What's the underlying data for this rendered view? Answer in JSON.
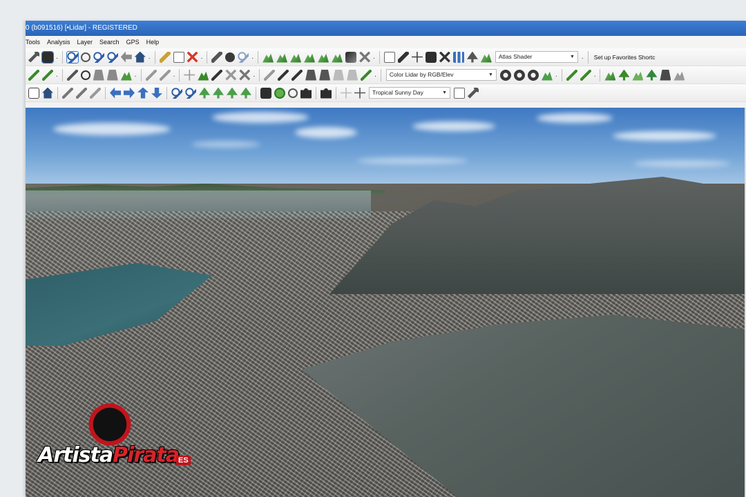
{
  "window": {
    "title": "0 (b091516) [•Lidar] - REGISTERED"
  },
  "menu": [
    "Tools",
    "Analysis",
    "Layer",
    "Search",
    "GPS",
    "Help"
  ],
  "toolbar1": {
    "shader_dropdown": "Atlas Shader",
    "favorites_label": "Set up Favorites Shortc"
  },
  "toolbar2": {
    "lidar_color_dropdown": "Color Lidar by RGB/Elev"
  },
  "toolbar3": {
    "sky_dropdown": "Tropical Sunny Day"
  },
  "watermark": {
    "word1": "Artista",
    "word2": "Pirata",
    "suffix": "ES"
  },
  "icons": {
    "toolbar1": [
      "wrench-icon",
      "layers-icon",
      "select-icon",
      "lasso-icon",
      "zoom-in-icon",
      "zoom-out-icon",
      "back-icon",
      "home-icon",
      "pencil-icon",
      "doc-icon",
      "delete-icon",
      "measure-icon",
      "info-icon",
      "search-icon",
      "terrain-icon",
      "terrain2-icon",
      "terrain3-icon",
      "terrain4-icon",
      "terrain5-icon",
      "terrain6-icon",
      "square-icon",
      "cross-icon",
      "grid-icon",
      "feature-icon",
      "crosshair-icon",
      "cube-icon",
      "percent-icon",
      "bars-icon",
      "tree-icon",
      "shader-icon"
    ],
    "toolbar2": [
      "line-icon",
      "node-icon",
      "measure2-icon",
      "target-icon",
      "building-icon",
      "building2-icon",
      "paint-icon",
      "check-icon",
      "edit-icon",
      "move-icon",
      "link-icon",
      "vertex-icon",
      "split-icon",
      "ruler-icon",
      "ruler2-icon",
      "wand-icon",
      "wand2-icon",
      "wand3-icon",
      "wand4-icon",
      "crop-icon",
      "marker-icon",
      "gear-icon",
      "gear2-icon",
      "gear3-icon",
      "filter-icon",
      "filter2-icon",
      "filter3-icon",
      "peak-icon",
      "grass-icon",
      "hill-icon",
      "tree2-icon",
      "tower-icon",
      "dish-icon"
    ],
    "toolbar3": [
      "cube2-icon",
      "home2-icon",
      "pencil2-icon",
      "erase-icon",
      "brush-icon",
      "arrow-left-icon",
      "arrow-right-icon",
      "arrow-up-icon",
      "arrow-down-icon",
      "zoom-in2-icon",
      "zoom-out2-icon",
      "tree3-icon",
      "tree4-icon",
      "tree5-icon",
      "tree6-icon",
      "book-icon",
      "play-icon",
      "record-icon",
      "camera-video-icon",
      "camera-icon",
      "compass-icon",
      "settings-icon",
      "tool-icon"
    ]
  }
}
